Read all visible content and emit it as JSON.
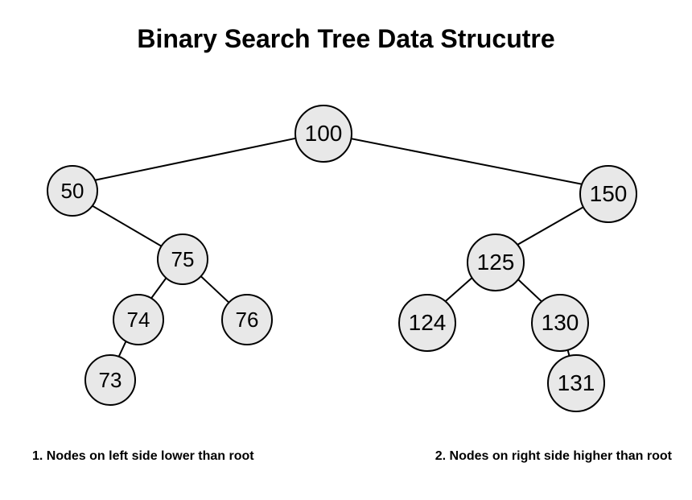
{
  "title": "Binary Search Tree  Data Strucutre",
  "chart_data": {
    "type": "tree",
    "title": "Binary Search Tree Data Structure",
    "nodes": {
      "root": {
        "value": 100,
        "left": "n50",
        "right": "n150"
      },
      "n50": {
        "value": 50,
        "left": null,
        "right": "n75"
      },
      "n150": {
        "value": 150,
        "left": "n125",
        "right": null
      },
      "n75": {
        "value": 75,
        "left": "n74",
        "right": "n76"
      },
      "n125": {
        "value": 125,
        "left": "n124",
        "right": "n130"
      },
      "n74": {
        "value": 74,
        "left": "n73",
        "right": null
      },
      "n76": {
        "value": 76,
        "left": null,
        "right": null
      },
      "n124": {
        "value": 124,
        "left": null,
        "right": null
      },
      "n130": {
        "value": 130,
        "left": null,
        "right": "n131"
      },
      "n73": {
        "value": 73,
        "left": null,
        "right": null
      },
      "n131": {
        "value": 131,
        "left": null,
        "right": null
      }
    },
    "annotations": [
      "1. Nodes on left side lower than root",
      "2. Nodes on right side higher than root"
    ]
  },
  "nodes": {
    "root": "100",
    "n50": "50",
    "n150": "150",
    "n75": "75",
    "n125": "125",
    "n74": "74",
    "n76": "76",
    "n124": "124",
    "n130": "130",
    "n73": "73",
    "n131": "131"
  },
  "captions": {
    "left": "1. Nodes on left side lower than root",
    "right": "2. Nodes on right side higher than root"
  }
}
